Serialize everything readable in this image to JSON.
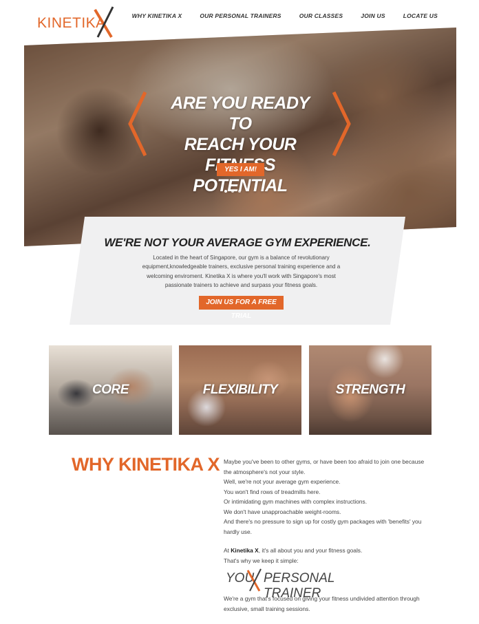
{
  "brand": {
    "logo_text": "KINETIKA",
    "logo_mark": "X",
    "accent": "#e2672a"
  },
  "nav": {
    "items": [
      {
        "label": "WHY KINETIKA X"
      },
      {
        "label": "OUR PERSONAL TRAINERS"
      },
      {
        "label": "OUR CLASSES"
      },
      {
        "label": "JOIN US"
      },
      {
        "label": "LOCATE US"
      }
    ]
  },
  "hero": {
    "title_line1": "ARE YOU READY TO",
    "title_line2": "REACH YOUR",
    "title_line3": "FITNESS POTENTIAL",
    "cta_label": "YES I AM!",
    "slides_count": 3,
    "active_slide": 1
  },
  "intro": {
    "title": "WE'RE NOT YOUR AVERAGE GYM EXPERIENCE.",
    "body": "Located in the heart of Singapore, our gym is a balance of revolutionary equipment,knowledgeable trainers, exclusive personal training experience and a welcoming enviroment. Kinetika X is where you'll work with Singapore's most passionate trainers to achieve and surpass your fitness goals.",
    "cta_label": "JOIN US FOR A FREE TRIAL"
  },
  "tiles": [
    {
      "label": "CORE"
    },
    {
      "label": "FLEXIBILITY"
    },
    {
      "label": "STRENGTH"
    }
  ],
  "why": {
    "title": "WHY KINETIKA X",
    "lines": [
      "Maybe you've been to other gyms, or have been too afraid to join one because the atmosphere's not your style.",
      "Well, we're not your average gym experience.",
      "You won't find rows of treadmills here.",
      "Or intimidating gym machines with complex instructions.",
      "We don't have unapproachable weight-rooms.",
      "And there's no pressure to sign up for costly gym packages with 'benefits' you hardly use."
    ],
    "at_prefix": "At ",
    "at_brand": "Kinetika X",
    "at_suffix": ", it's all about you and your fitness goals.",
    "simple_line": "That's why we keep it simple:",
    "tagline_left": "YOU",
    "tagline_mark": "X",
    "tagline_right": "PERSONAL TRAINER",
    "closing": "We're a gym that's focused on giving your fitness undivided attention through exclusive, small training sessions."
  }
}
